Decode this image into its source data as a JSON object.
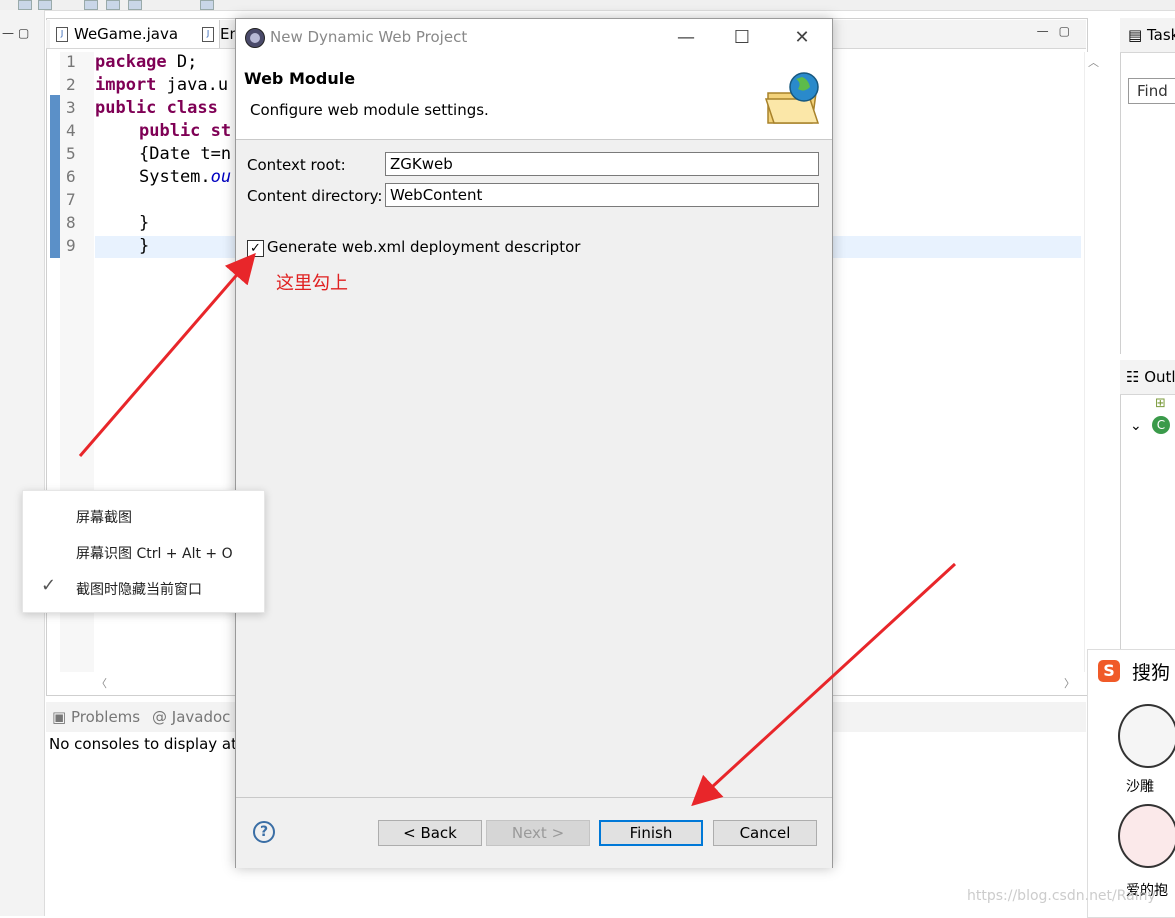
{
  "editor": {
    "tabs": [
      {
        "label": "WeGame.java"
      },
      {
        "label": "Em"
      }
    ],
    "line_numbers": [
      "1",
      "2",
      "3",
      "4",
      "5",
      "6",
      "7",
      "8",
      "9"
    ],
    "code_lines": {
      "l1_kw": "package",
      "l1_rest": " D;",
      "l2_kw": "import",
      "l2_rest": " java.u",
      "l3_kw": "public class",
      "l4_kw": "public st",
      "l5": "{Date t=n",
      "l6_a": "System.",
      "l6_b": "ou",
      "l8": "}",
      "l9": "}"
    }
  },
  "right_panels": {
    "tasks_label": "Task",
    "find_placeholder": "Find",
    "outline_label": "Outl"
  },
  "console": {
    "tab_problems": "Problems",
    "tab_javadoc": "Javadoc",
    "message": "No consoles to display at"
  },
  "dialog": {
    "title": "New Dynamic Web Project",
    "page_title": "Web Module",
    "page_description": "Configure web module settings.",
    "context_root_label": "Context root:",
    "context_root_value": "ZGKweb",
    "content_dir_label": "Content directory:",
    "content_dir_value": "WebContent",
    "generate_xml_label": "Generate web.xml deployment descriptor",
    "generate_xml_checked": true,
    "annotation": "这里勾上",
    "buttons": {
      "back": "< Back",
      "next": "Next >",
      "finish": "Finish",
      "cancel": "Cancel"
    }
  },
  "context_menu": {
    "items": [
      "屏幕截图",
      "屏幕识图 Ctrl + Alt + O",
      "截图时隐藏当前窗口"
    ]
  },
  "sogou": {
    "logo": "S",
    "title": "搜狗",
    "sticker1": "沙雕",
    "sticker2": "爱的抱"
  },
  "watermark": "https://blog.csdn.net/Rainy",
  "colors": {
    "annotation_red": "#e02020",
    "finish_border": "#0078d7",
    "keyword": "#7f0055"
  }
}
